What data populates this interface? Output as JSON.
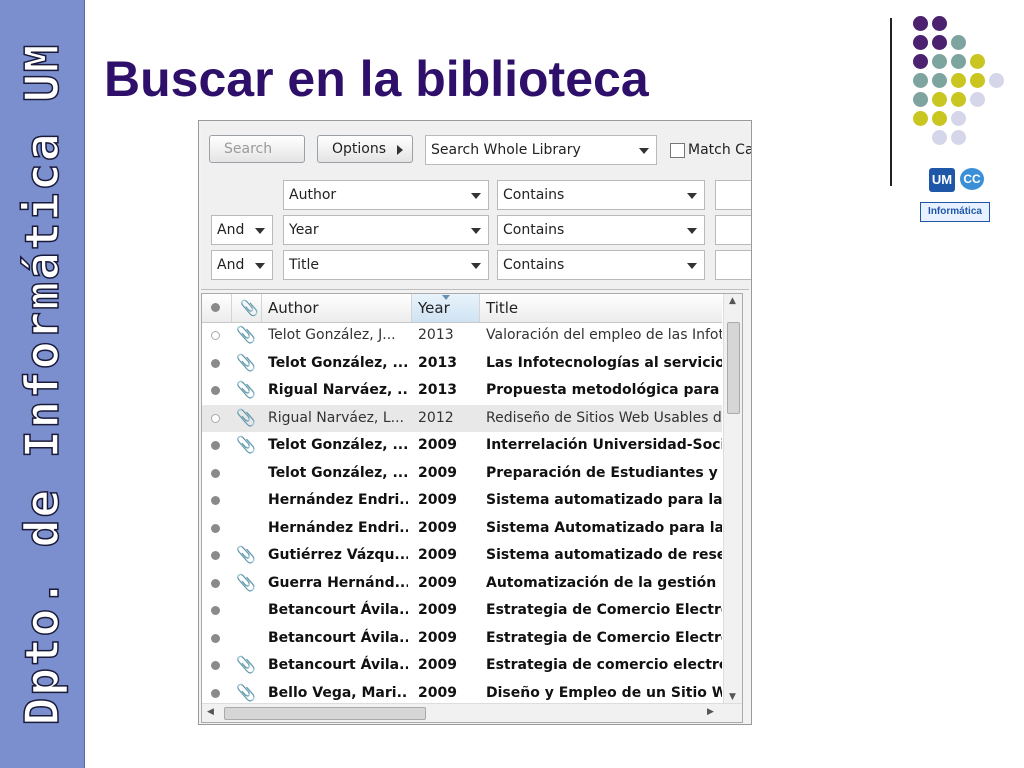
{
  "slide": {
    "title": "Buscar en la biblioteca",
    "side_label": "Dpto. de Informática UM",
    "logo": {
      "um": "UM",
      "cc": "CC",
      "label": "Informática"
    },
    "colors": {
      "sidebar": "#7b8fcf",
      "title": "#2e0f6a",
      "dot_purple": "#4b2170",
      "dot_teal": "#7ea4a0",
      "dot_yellow": "#c9c621",
      "dot_lavender": "#d6d6ea"
    }
  },
  "search": {
    "search_placeholder": "Search",
    "options_label": "Options",
    "scope_value": "Search Whole Library",
    "match_case_label": "Match Ca",
    "rows": [
      {
        "bool": "",
        "field": "Author",
        "operator": "Contains",
        "value": ""
      },
      {
        "bool": "And",
        "field": "Year",
        "operator": "Contains",
        "value": ""
      },
      {
        "bool": "And",
        "field": "Title",
        "operator": "Contains",
        "value": ""
      }
    ]
  },
  "results": {
    "columns": {
      "author": "Author",
      "year": "Year",
      "title": "Title"
    },
    "rows": [
      {
        "read": true,
        "attach": true,
        "author": "Telot González, J...",
        "year": "2013",
        "title": "Valoración del empleo de las Infot"
      },
      {
        "read": false,
        "attach": true,
        "author": "Telot González, ...",
        "year": "2013",
        "title": "Las Infotecnologías al servicio de"
      },
      {
        "read": false,
        "attach": true,
        "author": "Rigual Narváez, ...",
        "year": "2013",
        "title": "Propuesta metodológica para el"
      },
      {
        "read": true,
        "attach": true,
        "author": "Rigual Narváez, L...",
        "year": "2012",
        "title": "Rediseño de Sitios Web Usables de"
      },
      {
        "read": false,
        "attach": true,
        "author": "Telot González, ...",
        "year": "2009",
        "title": "Interrelación Universidad-Socied"
      },
      {
        "read": false,
        "attach": false,
        "author": "Telot González, ...",
        "year": "2009",
        "title": "Preparación de Estudiantes y Pro"
      },
      {
        "read": false,
        "attach": false,
        "author": "Hernández Endri...",
        "year": "2009",
        "title": "Sistema automatizado para la ge"
      },
      {
        "read": false,
        "attach": false,
        "author": "Hernández Endri...",
        "year": "2009",
        "title": "Sistema Automatizado para la Ge"
      },
      {
        "read": false,
        "attach": true,
        "author": "Gutiérrez Vázqu...",
        "year": "2009",
        "title": "Sistema automatizado de reserv"
      },
      {
        "read": false,
        "attach": true,
        "author": "Guerra Hernánd...",
        "year": "2009",
        "title": "Automatización de la gestión rer"
      },
      {
        "read": false,
        "attach": false,
        "author": "Betancourt Ávila...",
        "year": "2009",
        "title": "Estrategia de Comercio Electróni"
      },
      {
        "read": false,
        "attach": false,
        "author": "Betancourt Ávila...",
        "year": "2009",
        "title": "Estrategia de Comercio Electróni"
      },
      {
        "read": false,
        "attach": true,
        "author": "Betancourt Ávila...",
        "year": "2009",
        "title": "Estrategia de comercio electróni"
      },
      {
        "read": false,
        "attach": true,
        "author": "Bello Vega, Mari...",
        "year": "2009",
        "title": "Diseño y Empleo de un Sitio Web"
      }
    ]
  }
}
